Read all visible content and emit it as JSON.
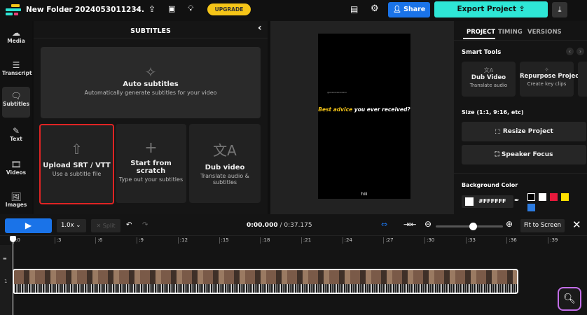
{
  "header": {
    "folder": "New Folder",
    "separator": ">",
    "project_name": "2024053011234.",
    "upgrade": "UPGRADE",
    "share": "Share",
    "export": "Export Project"
  },
  "nav": [
    {
      "label": "Media",
      "icon": "upload-cloud-icon"
    },
    {
      "label": "Transcript",
      "icon": "transcript-icon"
    },
    {
      "label": "Subtitles",
      "icon": "subtitles-icon"
    },
    {
      "label": "Text",
      "icon": "text-icon"
    },
    {
      "label": "Videos",
      "icon": "film-icon"
    },
    {
      "label": "Images",
      "icon": "image-icon"
    }
  ],
  "panel": {
    "title": "SUBTITLES",
    "auto": {
      "title": "Auto subtitles",
      "desc": "Automatically generate subtitles for your video"
    },
    "options": [
      {
        "title": "Upload SRT / VTT",
        "desc": "Use a subtitle file"
      },
      {
        "title": "Start from scratch",
        "desc": "Type out your subtitles"
      },
      {
        "title": "Dub video",
        "desc": "Translate audio & subtitles"
      }
    ]
  },
  "video": {
    "handle": "@xxxxxxxxxxxxxx",
    "caption_highlight": "Best advice",
    "caption_rest": " you ever received?",
    "footer": "hiii"
  },
  "right": {
    "tabs": [
      "PROJECT",
      "TIMING",
      "VERSIONS"
    ],
    "smart_tools": "Smart Tools",
    "tools": [
      {
        "title": "Dub Video",
        "desc": "Translate audio"
      },
      {
        "title": "Repurpose Project",
        "desc": "Create key clips"
      }
    ],
    "size_label": "Size (1:1, 9:16, etc)",
    "resize": "Resize Project",
    "speaker": "Speaker Focus",
    "bg_label": "Background Color",
    "bg_value": "#FFFFFF",
    "swatches": [
      "#000000",
      "#FFFFFF",
      "#E8193C",
      "#FFE000",
      "#2C7BE0"
    ]
  },
  "timeline": {
    "speed": "1.0x",
    "split": "Split",
    "current": "0:00.000",
    "total": "/ 0:37.175",
    "fit": "Fit to Screen",
    "zoom_level": 0.55,
    "ticks": [
      ":0",
      ":3",
      ":6",
      ":9",
      ":12",
      ":15",
      ":18",
      ":21",
      ":24",
      ":27",
      ":30",
      ":33",
      ":36",
      ":39"
    ],
    "track_number": "1"
  },
  "colors": {
    "accent": "#1A73E8",
    "export": "#2EE6D6",
    "upgrade": "#F5C518",
    "highlight": "#F5C518"
  }
}
